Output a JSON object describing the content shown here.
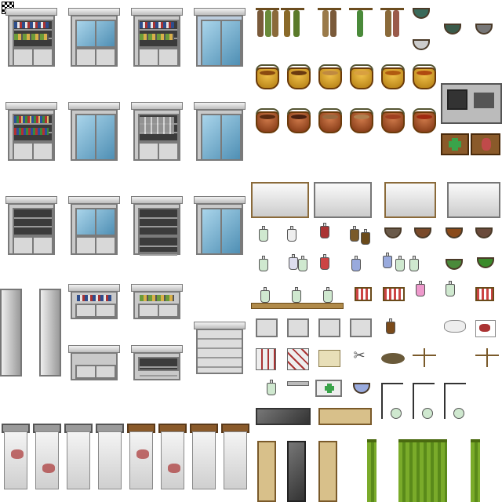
{
  "sheet": {
    "background": "#ffffff",
    "kind": "tileset",
    "sections": [
      "cabinets-glass",
      "herbs-and-pots",
      "hospital-beds",
      "bottles-and-tools",
      "curtains"
    ]
  },
  "palette": {
    "glass": "#4f8fb4",
    "metal": "#c9c9c9",
    "gold_pot": "#b07a10",
    "copper_pot": "#7a3210",
    "curtain": "#7aab2a",
    "bed_stain": "#aa3333",
    "wood": "#8a5a2a",
    "dark_stone": "#444444"
  },
  "icons": {
    "corner": "checker-icon",
    "herb": "herb-bundle-icon",
    "pot": "pot-icon",
    "bottle": "bottle-icon",
    "bowl": "bowl-icon",
    "bed": "bed-icon",
    "scale": "scale-icon",
    "curtain": "curtain-icon",
    "stand": "iv-stand-icon"
  }
}
